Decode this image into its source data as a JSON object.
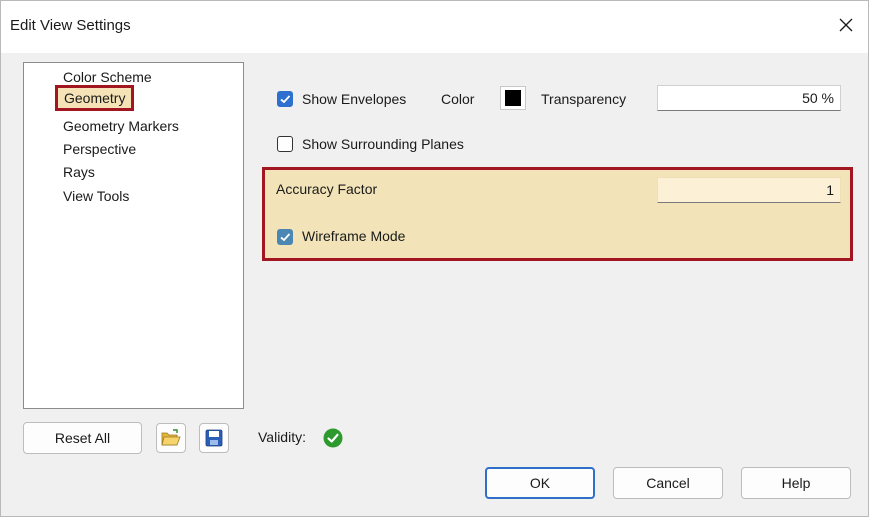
{
  "window": {
    "title": "Edit View Settings"
  },
  "tree": {
    "items": [
      {
        "label": "Color Scheme",
        "selected": false
      },
      {
        "label": "Geometry",
        "selected": true
      },
      {
        "label": "Geometry Markers",
        "selected": false
      },
      {
        "label": "Perspective",
        "selected": false
      },
      {
        "label": "Rays",
        "selected": false
      },
      {
        "label": "View Tools",
        "selected": false
      }
    ]
  },
  "settings": {
    "show_envelopes": {
      "label": "Show Envelopes",
      "checked": true
    },
    "color_label": "Color",
    "color_value": "#000000",
    "transparency_label": "Transparency",
    "transparency_value": "50 %",
    "show_surrounding_planes": {
      "label": "Show Surrounding Planes",
      "checked": false
    },
    "accuracy_factor_label": "Accuracy Factor",
    "accuracy_factor_value": "1",
    "wireframe_mode": {
      "label": "Wireframe Mode",
      "checked": true
    }
  },
  "footer": {
    "reset_all_label": "Reset All",
    "validity_label": "Validity:",
    "validity_status": "valid",
    "ok_label": "OK",
    "cancel_label": "Cancel",
    "help_label": "Help"
  },
  "colors": {
    "highlight_border": "#a21621",
    "highlight_fill": "#f2e4b8",
    "checkbox_accent": "#2e6fcf",
    "valid_green": "#2e9a2e"
  }
}
